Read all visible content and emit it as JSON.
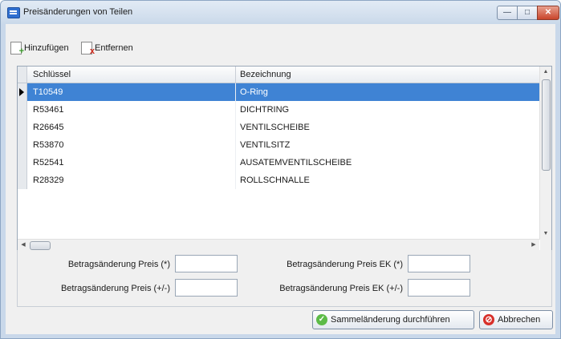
{
  "window": {
    "title": "Preisänderungen von Teilen",
    "controls": {
      "minimize": "—",
      "maximize": "□",
      "close": "✕"
    }
  },
  "toolbar": {
    "add_label": "Hinzufügen",
    "remove_label": "Entfernen",
    "add_icon": "document-add-icon",
    "remove_icon": "document-remove-icon"
  },
  "grid": {
    "columns": [
      "Schlüssel",
      "Bezeichnung"
    ],
    "rows": [
      {
        "key": "T10549",
        "name": "O-Ring"
      },
      {
        "key": "R53461",
        "name": "DICHTRING"
      },
      {
        "key": "R26645",
        "name": "VENTILSCHEIBE"
      },
      {
        "key": "R53870",
        "name": "VENTILSITZ"
      },
      {
        "key": "R52541",
        "name": "AUSATEMVENTILSCHEIBE"
      },
      {
        "key": "R28329",
        "name": "ROLLSCHNALLE"
      }
    ],
    "selected_row": 0
  },
  "fields": {
    "preis_percent_label": "Betragsänderung Preis (*)",
    "preis_percent_value": "",
    "preis_ek_percent_label": "Betragsänderung Preis EK (*)",
    "preis_ek_percent_value": "",
    "preis_abs_label": "Betragsänderung Preis (+/-)",
    "preis_abs_value": "",
    "preis_ek_abs_label": "Betragsänderung Preis EK (+/-)",
    "preis_ek_abs_value": ""
  },
  "buttons": {
    "apply_label": "Sammeländerung durchführen",
    "cancel_label": "Abbrechen"
  },
  "colors": {
    "selection": "#3f83d4",
    "window_border": "#8da6c4",
    "client_bg": "#f0f0f0"
  }
}
